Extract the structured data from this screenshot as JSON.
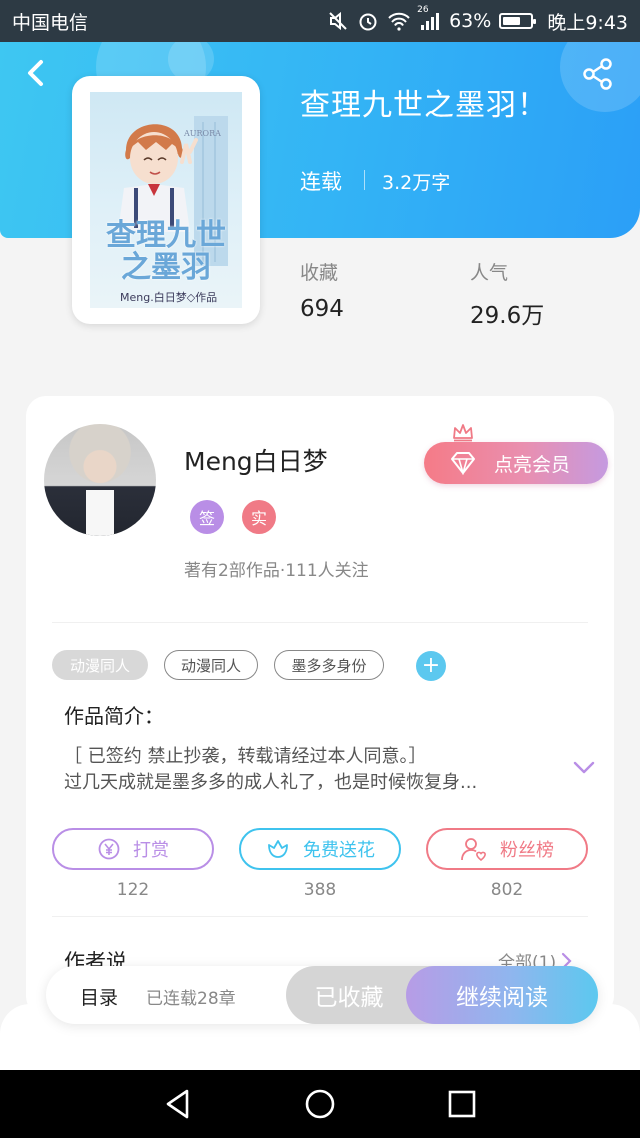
{
  "status_bar": {
    "carrier": "中国电信",
    "network": "26",
    "battery_level": "63%",
    "time": "晚上9:43",
    "icons": [
      "mute-icon",
      "alarm-icon",
      "wifi-icon",
      "signal-icon",
      "battery-icon"
    ],
    "battery_fill": 0.63
  },
  "header": {
    "icons": {
      "back": "chevron-left-icon",
      "share": "share-icon"
    },
    "colors": {
      "gradient_start": "#3ec7f2",
      "gradient_end": "#2b9ff7"
    }
  },
  "book": {
    "title": "查理九世之墨羽！",
    "status": "连载",
    "word_count": "3.2万字",
    "cover": {
      "title_line1": "查理九世",
      "title_line2": "之墨羽",
      "author": "Meng.白日梦◇作品",
      "brand": "AURORA"
    },
    "stats": [
      {
        "label": "收藏",
        "value": "694"
      },
      {
        "label": "人气",
        "value": "29.6万"
      }
    ]
  },
  "author": {
    "name": "Meng白日梦",
    "badges": [
      {
        "label": "签",
        "color": "#b98ee6"
      },
      {
        "label": "实",
        "color": "#f07a86"
      }
    ],
    "meta": "著有2部作品·111人关注",
    "vip_label": "点亮会员"
  },
  "tags": [
    "动漫同人",
    "动漫同人",
    "墨多多身份"
  ],
  "intro": {
    "title": "作品简介：",
    "line1": "［ 已签约 禁止抄袭，转载请经过本人同意。］",
    "line2": "过几天成就是墨多多的成人礼了，也是时候恢复身..."
  },
  "actions": [
    {
      "label": "打赏",
      "count": "122",
      "color": "#b98ee6",
      "icon": "yen-coin-icon"
    },
    {
      "label": "免费送花",
      "count": "388",
      "color": "#3fc3ee",
      "icon": "flower-icon"
    },
    {
      "label": "粉丝榜",
      "count": "802",
      "color": "#f07a86",
      "icon": "fan-rank-icon"
    }
  ],
  "author_says": {
    "title": "作者说",
    "all_link": "全部(1)"
  },
  "bottom_bar": {
    "toc_label": "目录",
    "toc_status": "已连载28章",
    "collected_label": "已收藏",
    "read_label": "继续阅读"
  },
  "nav_bar": {
    "icons": [
      "back-triangle-icon",
      "home-circle-icon",
      "recent-square-icon"
    ]
  }
}
